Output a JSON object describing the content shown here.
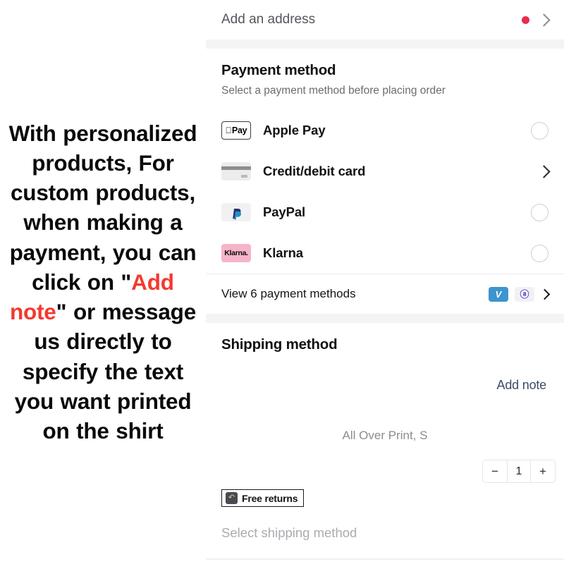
{
  "caption": {
    "part1": "With personalized products, For custom products, when making a payment, you can click on ",
    "quote_open": "\"",
    "highlight": "Add note",
    "quote_close": "\"",
    "part2": " or message us directly to specify the text you want printed on the shirt",
    "highlight_color": "#f4392f"
  },
  "address": {
    "label": "Add an address",
    "dot_color": "#e62e4d"
  },
  "payment": {
    "title": "Payment method",
    "subtitle": "Select a payment method before placing order",
    "options": [
      {
        "name": "Apple Pay",
        "icon": "apple-pay-icon",
        "badge_text": "Pay",
        "control": "radio"
      },
      {
        "name": "Credit/debit card",
        "icon": "credit-card-icon",
        "badge_text": "",
        "control": "chevron"
      },
      {
        "name": "PayPal",
        "icon": "paypal-icon",
        "badge_text": "P",
        "control": "radio"
      },
      {
        "name": "Klarna",
        "icon": "klarna-icon",
        "badge_text": "Klarna.",
        "control": "radio"
      }
    ],
    "view_more_label": "View 6 payment methods",
    "mini_badges": [
      {
        "name": "venmo-icon",
        "text": "V",
        "color": "#3d95ce"
      },
      {
        "name": "affirm-icon",
        "text": "ⓐ",
        "color": "#f1f1f3"
      }
    ]
  },
  "shipping": {
    "title": "Shipping method",
    "add_note_label": "Add note",
    "variant": "All Over Print, S",
    "quantity": "1",
    "decrement": "−",
    "increment": "+",
    "free_returns": "Free returns",
    "returns_icon": "return-arrow-icon",
    "select_placeholder": "Select shipping method"
  },
  "annotation": {
    "box_color": "#ee2d24",
    "arrow_color": "#ee2d24"
  }
}
